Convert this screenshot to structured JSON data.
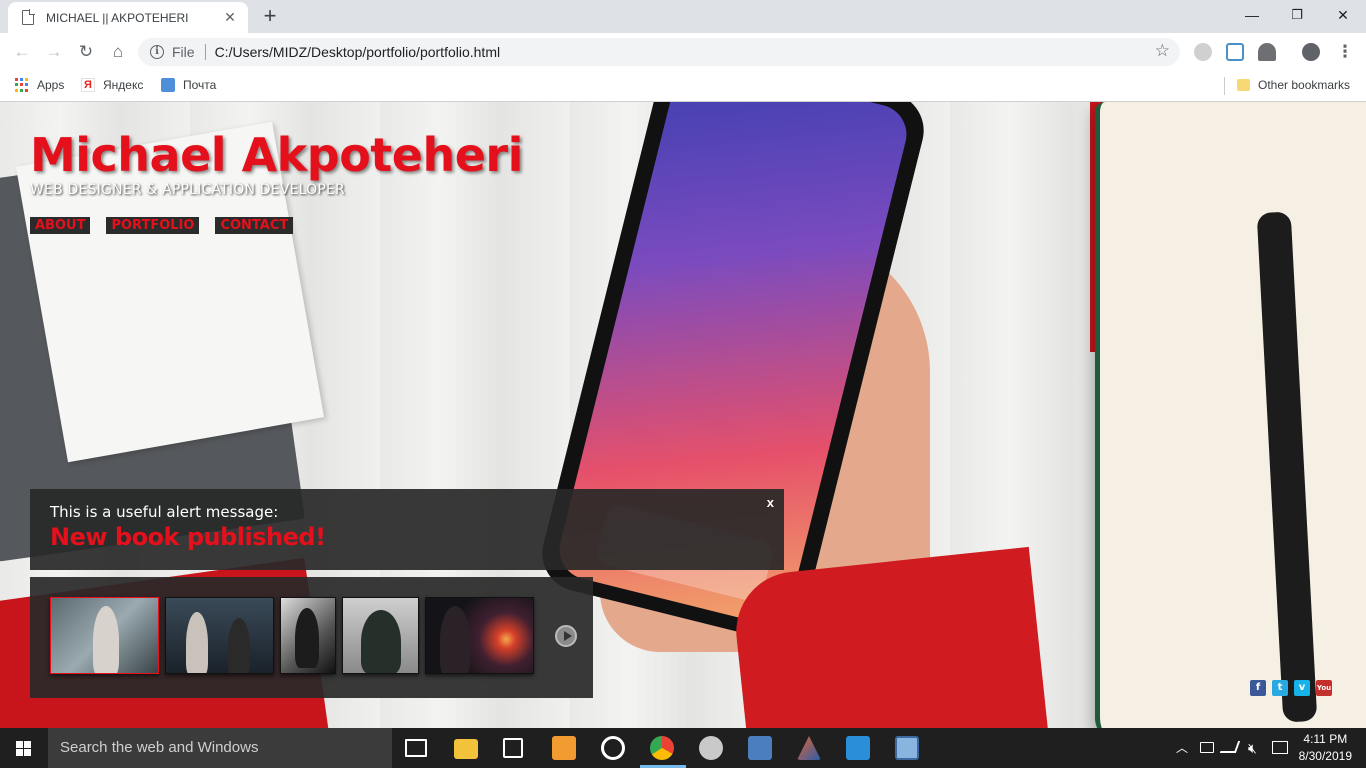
{
  "browser": {
    "tab_title": "MICHAEL || AKPOTEHERI",
    "tab_close": "✕",
    "new_tab": "+",
    "scheme_label": "File",
    "url": "C:/Users/MIDZ/Desktop/portfolio/portfolio.html",
    "window_controls": {
      "minimize": "—",
      "maximize": "❐",
      "close": "✕"
    },
    "bookmarks": [
      {
        "label": "Apps",
        "icon": "apps-grid-icon"
      },
      {
        "label": "Яндекс",
        "icon": "yandex-icon"
      },
      {
        "label": "Почта",
        "icon": "mail-icon"
      }
    ],
    "other_bookmarks": "Other bookmarks"
  },
  "page": {
    "title": "Michael Akpoteheri",
    "subtitle": "WEB DESIGNER & APPLICATION DEVELOPER",
    "menu": [
      "ABOUT",
      "PORTFOLIO",
      "CONTACT"
    ],
    "alert": {
      "message": "This is a useful alert message:",
      "headline": "New book published!",
      "close": "x"
    },
    "gallery": {
      "thumbnail_count": 5,
      "selected_index": 0
    },
    "social": [
      {
        "name": "facebook-icon",
        "glyph": "f",
        "color": "#3b5998"
      },
      {
        "name": "twitter-icon",
        "glyph": "t",
        "color": "#2aa9e0"
      },
      {
        "name": "vimeo-icon",
        "glyph": "v",
        "color": "#17b3e8"
      },
      {
        "name": "youtube-icon",
        "glyph": "You",
        "color": "#c4302b"
      }
    ],
    "colors": {
      "accent": "#e4101b",
      "panel": "#282828"
    }
  },
  "taskbar": {
    "search_placeholder": "Search the web and Windows",
    "time": "4:11 PM",
    "date": "8/30/2019"
  }
}
